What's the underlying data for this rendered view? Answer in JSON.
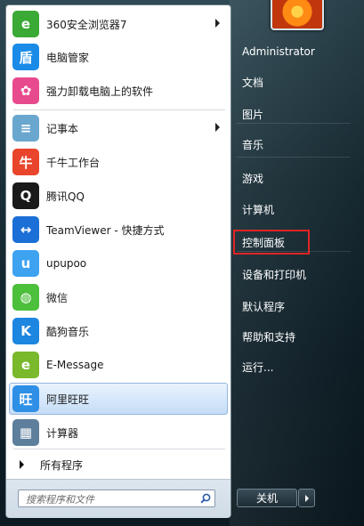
{
  "left": {
    "items": [
      {
        "label": "360安全浏览器7",
        "icon": "browser-360-icon",
        "color": "#3ba935",
        "glyph": "e",
        "submenu": true
      },
      {
        "label": "电脑管家",
        "icon": "shield-icon",
        "color": "#1a8ce8",
        "glyph": "盾",
        "submenu": false
      },
      {
        "label": "强力卸载电脑上的软件",
        "icon": "uninstall-icon",
        "color": "#e84a8e",
        "glyph": "✿",
        "submenu": false
      },
      {
        "label": "记事本",
        "icon": "notepad-icon",
        "color": "#6aa7cf",
        "glyph": "≡",
        "submenu": true
      },
      {
        "label": "千牛工作台",
        "icon": "qianniu-icon",
        "color": "#e8452c",
        "glyph": "牛",
        "submenu": false
      },
      {
        "label": "腾讯QQ",
        "icon": "qq-penguin-icon",
        "color": "#1a1a1a",
        "glyph": "Q",
        "submenu": false
      },
      {
        "label": "TeamViewer - 快捷方式",
        "icon": "teamviewer-icon",
        "color": "#1b6fd6",
        "glyph": "↔",
        "submenu": false
      },
      {
        "label": "upupoo",
        "icon": "upupoo-icon",
        "color": "#3da2f0",
        "glyph": "u",
        "submenu": false
      },
      {
        "label": "微信",
        "icon": "wechat-icon",
        "color": "#4cbf3b",
        "glyph": "◍",
        "submenu": false
      },
      {
        "label": "酷狗音乐",
        "icon": "kugou-icon",
        "color": "#1d86e0",
        "glyph": "K",
        "submenu": false
      },
      {
        "label": "E-Message",
        "icon": "emessage-icon",
        "color": "#7ab82c",
        "glyph": "e",
        "submenu": false
      },
      {
        "label": "阿里旺旺",
        "icon": "aliwangwang-icon",
        "color": "#2e8fe6",
        "glyph": "旺",
        "submenu": false,
        "selected": true
      },
      {
        "label": "计算器",
        "icon": "calculator-icon",
        "color": "#5d7f9c",
        "glyph": "▦",
        "submenu": false
      }
    ],
    "all_programs": "所有程序",
    "search_placeholder": "搜索程序和文件"
  },
  "right": {
    "items": [
      {
        "label": "Administrator"
      },
      {
        "label": "文档"
      },
      {
        "label": "图片"
      },
      {
        "label": "音乐"
      },
      {
        "label": "游戏"
      },
      {
        "label": "计算机"
      },
      {
        "label": "控制面板",
        "highlight": true
      },
      {
        "label": "设备和打印机"
      },
      {
        "label": "默认程序"
      },
      {
        "label": "帮助和支持"
      },
      {
        "label": "运行..."
      }
    ],
    "shutdown_label": "关机"
  }
}
